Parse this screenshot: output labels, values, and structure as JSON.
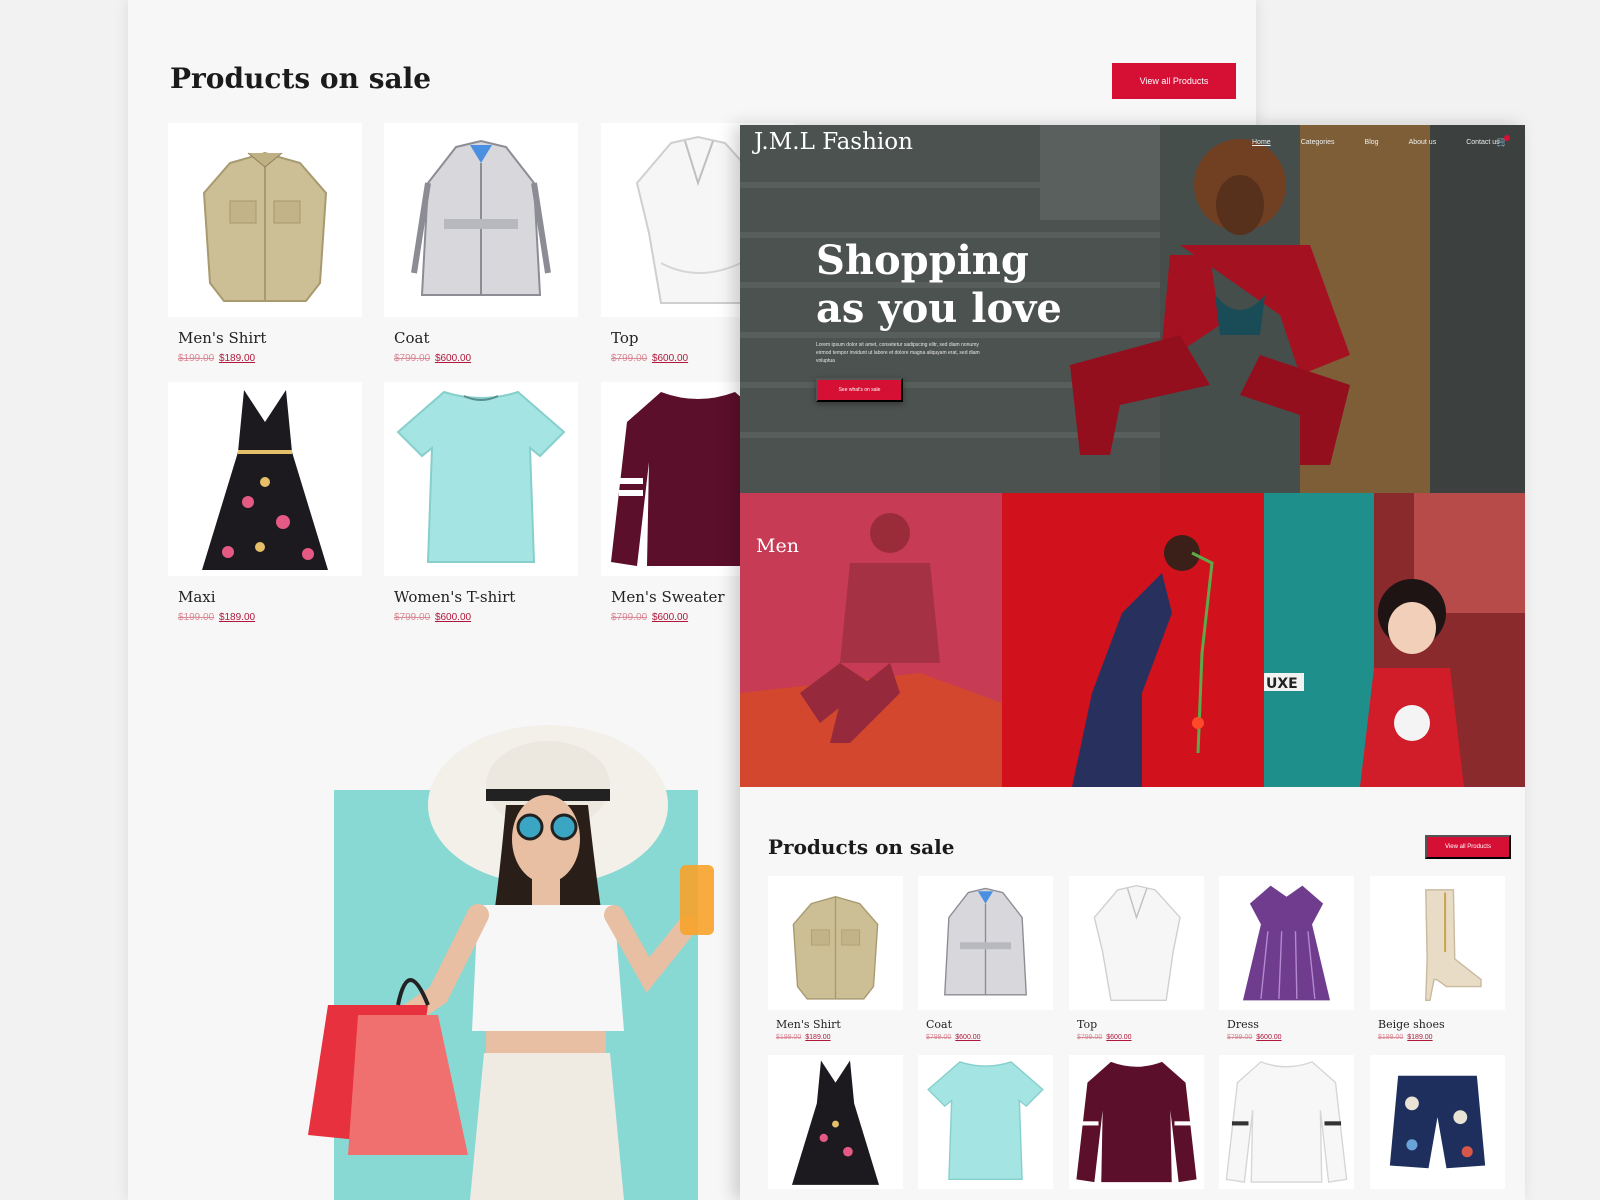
{
  "back": {
    "section_title": "Products on sale",
    "view_all": "View all Products",
    "products": [
      {
        "name": "Men's Shirt",
        "old_price": "$199.00",
        "price": "$189.00"
      },
      {
        "name": "Coat",
        "old_price": "$799.00",
        "price": "$600.00"
      },
      {
        "name": "Top",
        "old_price": "$799.00",
        "price": "$600.00"
      },
      {
        "name": "Maxi",
        "old_price": "$199.00",
        "price": "$189.00"
      },
      {
        "name": "Women's T-shirt",
        "old_price": "$799.00",
        "price": "$600.00"
      },
      {
        "name": "Men's Sweater",
        "old_price": "$799.00",
        "price": "$600.00"
      }
    ]
  },
  "front": {
    "brand": "J.M.L Fashion",
    "nav": [
      "Home",
      "Categories",
      "Blog",
      "About us",
      "Contact us"
    ],
    "hero_title": "Shopping as you love",
    "hero_text": "Lorem ipsum dolor sit amet, consetetur sadipscing elitr, sed diam nonumy eirmod tempor invidunt ut labore et dolore magna aliquyam erat, sed diam voluptua",
    "hero_button": "See what's on sale",
    "category_men": "Men",
    "section_title": "Products on sale",
    "view_all": "View all Products",
    "products": [
      {
        "name": "Men's Shirt",
        "old_price": "$199.00",
        "price": "$189.00"
      },
      {
        "name": "Coat",
        "old_price": "$799.00",
        "price": "$600.00"
      },
      {
        "name": "Top",
        "old_price": "$799.00",
        "price": "$600.00"
      },
      {
        "name": "Dress",
        "old_price": "$799.00",
        "price": "$600.00"
      },
      {
        "name": "Beige shoes",
        "old_price": "$199.00",
        "price": "$189.00"
      }
    ]
  },
  "colors": {
    "accent": "#d60f35",
    "promo_bg": "#88d8d4",
    "men_overlay": "#c73b55"
  }
}
